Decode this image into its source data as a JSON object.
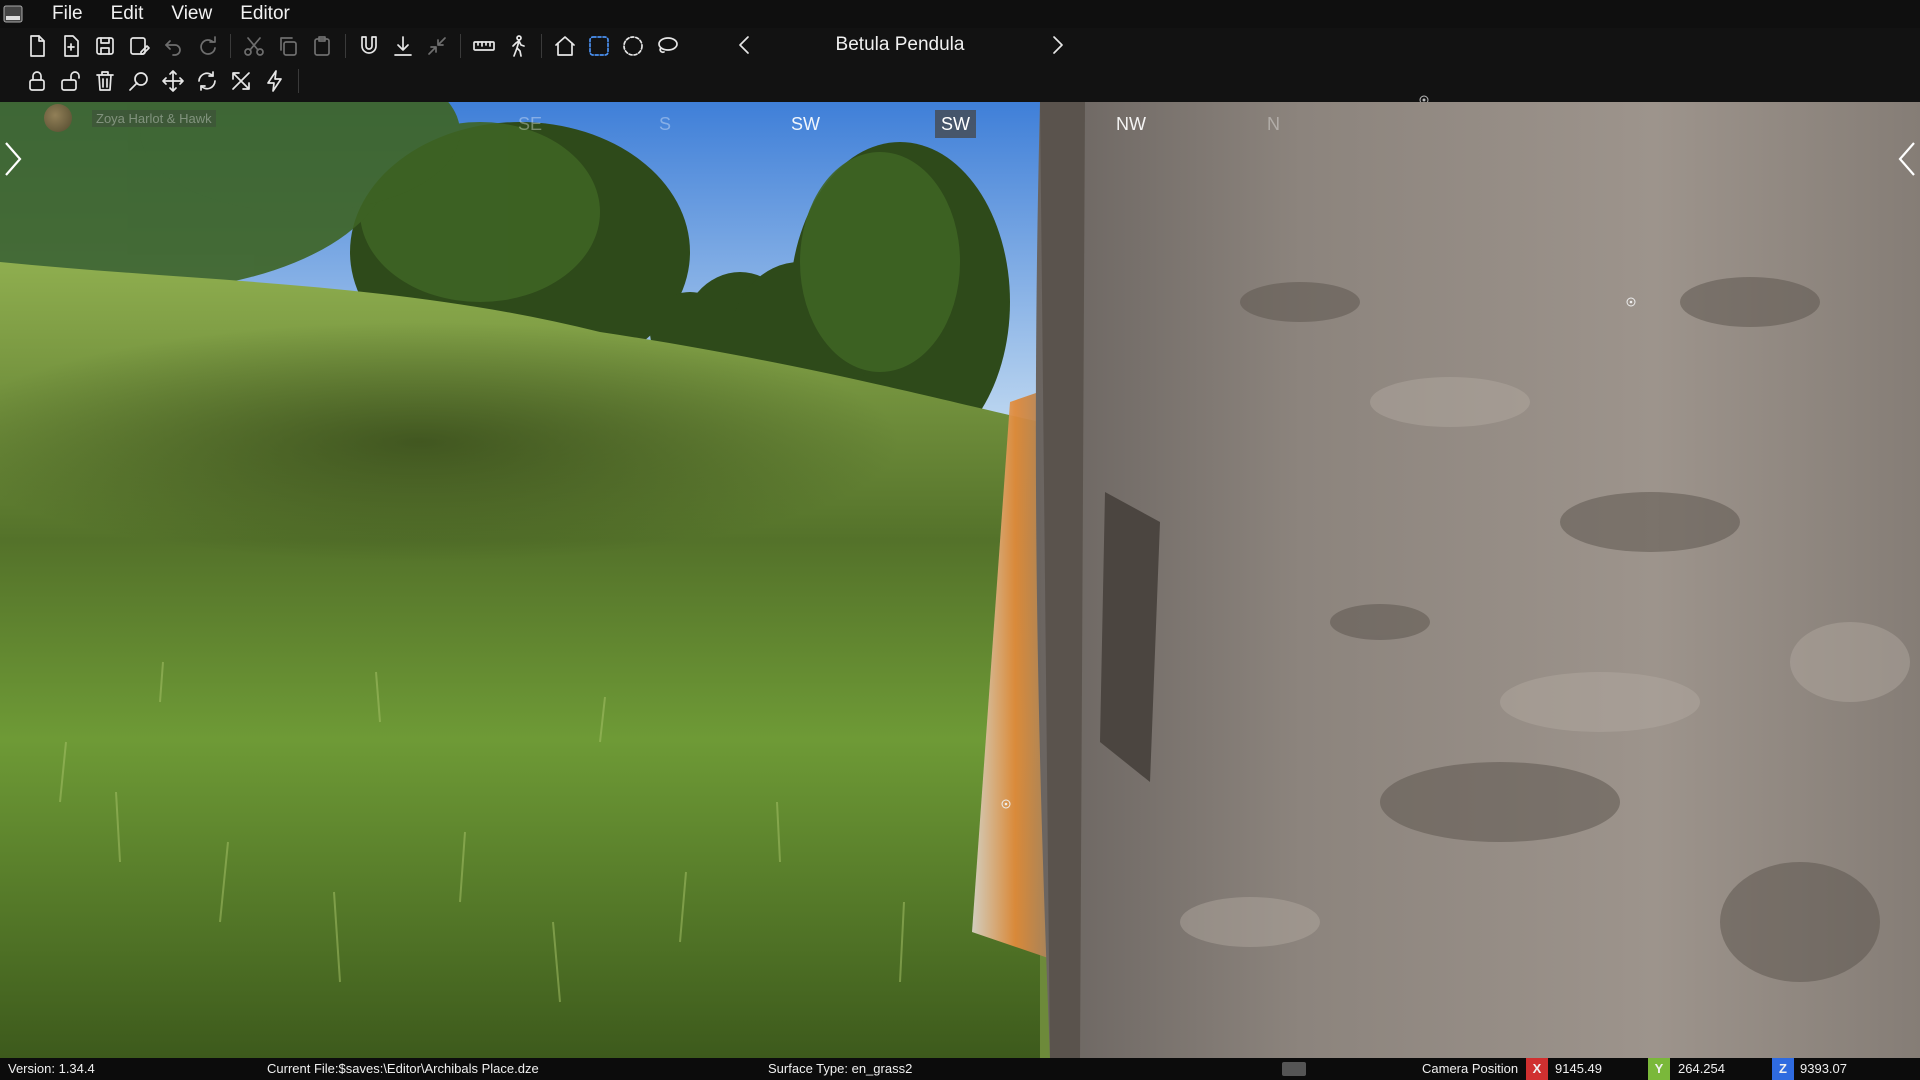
{
  "menubar": {
    "items": [
      {
        "label": "File"
      },
      {
        "label": "Edit"
      },
      {
        "label": "View"
      },
      {
        "label": "Editor"
      }
    ]
  },
  "toolbar": {
    "selected_object": "Betula Pendula",
    "icons_row1": [
      "new-file-icon",
      "open-file-icon",
      "save-icon",
      "save-as-icon",
      "undo-icon",
      "redo-icon",
      "cut-icon",
      "copy-icon",
      "paste-icon",
      "magnet-icon",
      "ground-snap-icon",
      "collapse-icon",
      "measure-icon",
      "walk-icon",
      "home-icon",
      "box-select-icon",
      "circle-select-icon",
      "lasso-select-icon"
    ],
    "icons_row2": [
      "lock-icon",
      "unlock-icon",
      "delete-icon",
      "search-icon",
      "move-icon",
      "rotate-icon",
      "scale-icon",
      "lightning-icon"
    ]
  },
  "viewport": {
    "compass": [
      {
        "label": "SE",
        "state": "faded"
      },
      {
        "label": "S",
        "state": "faded"
      },
      {
        "label": "SW",
        "state": "normal"
      },
      {
        "label": "SW",
        "state": "current"
      },
      {
        "label": "NW",
        "state": "normal"
      },
      {
        "label": "N",
        "state": "faded"
      }
    ],
    "overlay_user": "Zoya Harlot & Hawk"
  },
  "statusbar": {
    "version": "Version:  1.34.4",
    "current_file": "Current File:$saves:\\Editor\\Archibals Place.dze",
    "surface_type": "Surface Type: en_grass2",
    "camera_position_label": "Camera Position",
    "x_label": "X",
    "x_value": "9145.49",
    "y_label": "Y",
    "y_value": "264.254",
    "z_label": "Z",
    "z_value": "9393.07"
  },
  "colors": {
    "x_axis": "#d03030",
    "y_axis": "#7ab83a",
    "z_axis": "#2f6be0",
    "active_tool": "#4a90f0"
  }
}
